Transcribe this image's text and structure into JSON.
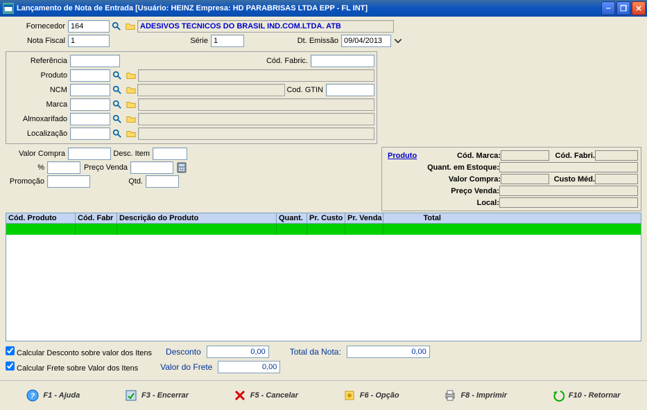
{
  "titlebar": {
    "text": "Lançamento de Nota de Entrada [Usuário: HEINZ  Empresa: HD PARABRISAS LTDA EPP - FL INT]"
  },
  "form": {
    "fornecedor_label": "Fornecedor",
    "fornecedor_value": "164",
    "fornecedor_nome": "ADESIVOS TECNICOS DO BRASIL IND.COM.LTDA. ATB",
    "nota_fiscal_label": "Nota Fiscal",
    "nota_fiscal_value": "1",
    "serie_label": "Série",
    "serie_value": "1",
    "dt_emissao_label": "Dt. Emissão",
    "dt_emissao_value": "09/04/2013",
    "referencia_label": "Referência",
    "cod_fabric_label": "Cód. Fabric.",
    "produto_label": "Produto",
    "ncm_label": "NCM",
    "cod_gtin_label": "Cod. GTIN",
    "marca_label": "Marca",
    "almoxarifado_label": "Almoxarifado",
    "localizacao_label": "Localização"
  },
  "price": {
    "valor_compra_label": "Valor Compra",
    "desc_item_label": "Desc. Item",
    "pct_label": "%",
    "preco_venda_label": "Preço  Venda",
    "promocao_label": "Promoção",
    "qtd_label": "Qtd."
  },
  "side": {
    "produto_link": "Produto",
    "cod_marca_label": "Cód. Marca:",
    "cod_fabri_label": "Cód. Fabri.",
    "quant_estoque_label": "Quant. em Estoque:",
    "valor_compra_label": "Valor Compra:",
    "custo_med_label": "Custo Méd.",
    "preco_venda_label": "Preço Venda:",
    "local_label": "Local:"
  },
  "grid": {
    "headers": [
      "Cód. Produto",
      "Cód. Fabr",
      "Descrição do Produto",
      "Quant.",
      "Pr. Custo",
      "Pr. Venda",
      "Total"
    ]
  },
  "bottom": {
    "chk_desconto_label": "Calcular Desconto sobre valor dos Itens",
    "chk_frete_label": "Calcular Frete sobre Valor dos Itens",
    "desconto_label": "Desconto",
    "desconto_value": "0,00",
    "total_nota_label": "Total da Nota:",
    "total_nota_value": "0,00",
    "valor_frete_label": "Valor do Frete",
    "valor_frete_value": "0,00"
  },
  "buttons": {
    "f1": "F1 - Ajuda",
    "f3": "F3 - Encerrar",
    "f5": "F5 - Cancelar",
    "f6": "F6 - Opção",
    "f8": "F8 - Imprimir",
    "f10": "F10 - Retornar"
  }
}
